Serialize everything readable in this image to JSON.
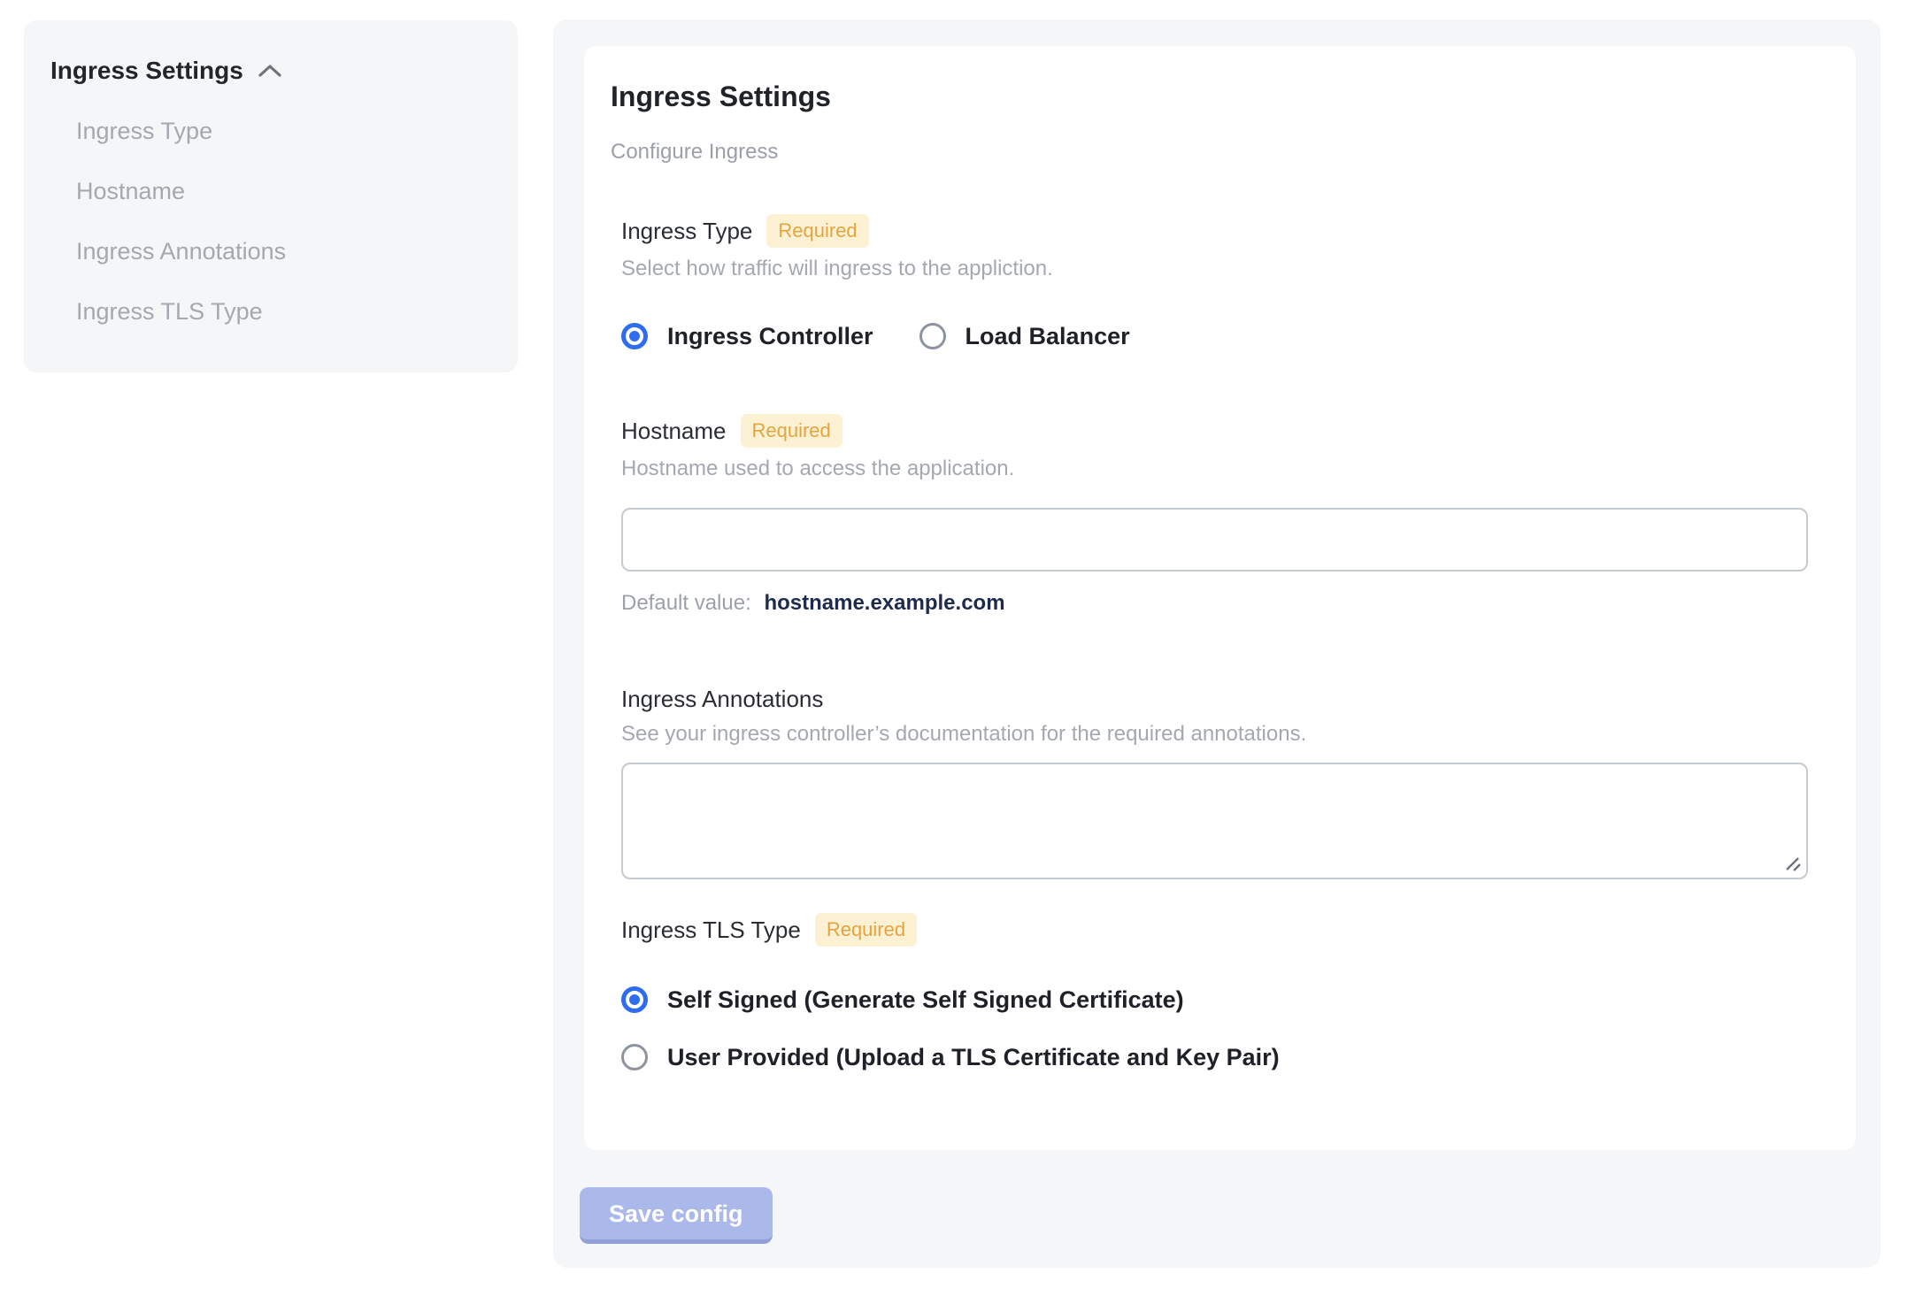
{
  "colors": {
    "panel_bg": "#f4f6f8",
    "card_bg": "#ffffff",
    "accent_blue": "#2e6cf0",
    "badge_bg": "#fdf1d3",
    "badge_text": "#e4a43f",
    "muted_text": "#a4a8af",
    "default_value_text": "#1d2b4f",
    "save_button_bg": "#aab9ea"
  },
  "sidebar": {
    "title": "Ingress Settings",
    "collapse_icon": "chevron-up-icon",
    "items": [
      {
        "label": "Ingress Type"
      },
      {
        "label": "Hostname"
      },
      {
        "label": "Ingress Annotations"
      },
      {
        "label": "Ingress TLS Type"
      }
    ]
  },
  "main": {
    "card": {
      "title": "Ingress Settings",
      "subtitle": "Configure Ingress",
      "sections": {
        "ingress_type": {
          "label": "Ingress Type",
          "required_badge": "Required",
          "description": "Select how traffic will ingress to the appliction.",
          "options": [
            {
              "label": "Ingress Controller",
              "selected": true
            },
            {
              "label": "Load Balancer",
              "selected": false
            }
          ]
        },
        "hostname": {
          "label": "Hostname",
          "required_badge": "Required",
          "description": "Hostname used to access the application.",
          "input_value": "",
          "default_value_label": "Default value:",
          "default_value": "hostname.example.com"
        },
        "ingress_annotations": {
          "label": "Ingress Annotations",
          "description": "See your ingress controller’s documentation for the required annotations.",
          "textarea_value": ""
        },
        "ingress_tls_type": {
          "label": "Ingress TLS Type",
          "required_badge": "Required",
          "options": [
            {
              "label": "Self Signed (Generate Self Signed Certificate)",
              "selected": true
            },
            {
              "label": "User Provided (Upload a TLS Certificate and Key Pair)",
              "selected": false
            }
          ]
        }
      }
    },
    "save_button_label": "Save config"
  }
}
